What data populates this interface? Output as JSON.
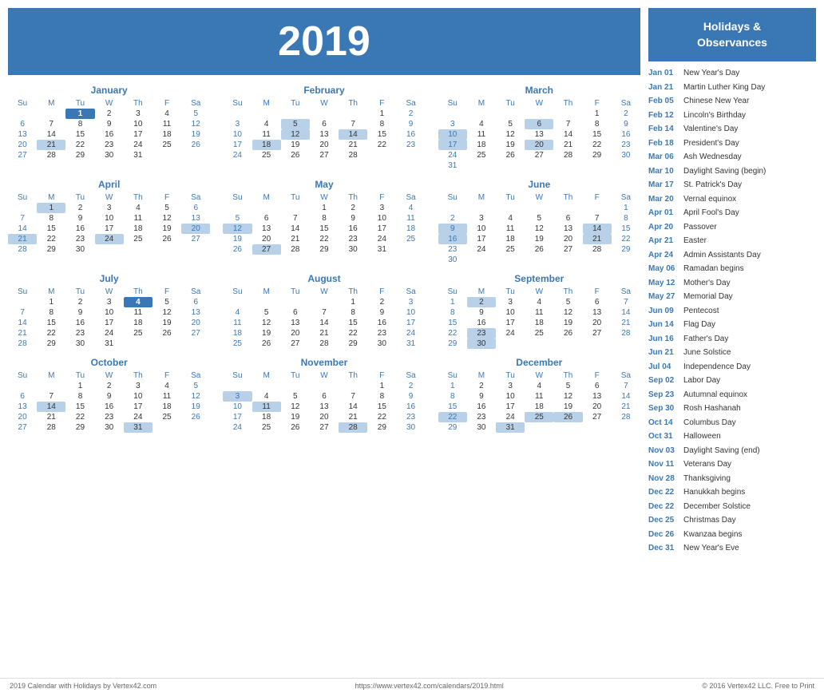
{
  "year": "2019",
  "holidays_title": "Holidays &\nObservances",
  "footer": {
    "left": "2019 Calendar with Holidays by Vertex42.com",
    "center": "https://www.vertex42.com/calendars/2019.html",
    "right": "© 2016 Vertex42 LLC. Free to Print"
  },
  "holidays": [
    {
      "date": "Jan 01",
      "name": "New Year's Day"
    },
    {
      "date": "Jan 21",
      "name": "Martin Luther King Day"
    },
    {
      "date": "Feb 05",
      "name": "Chinese New Year"
    },
    {
      "date": "Feb 12",
      "name": "Lincoln's Birthday"
    },
    {
      "date": "Feb 14",
      "name": "Valentine's Day"
    },
    {
      "date": "Feb 18",
      "name": "President's Day"
    },
    {
      "date": "Mar 06",
      "name": "Ash Wednesday"
    },
    {
      "date": "Mar 10",
      "name": "Daylight Saving (begin)"
    },
    {
      "date": "Mar 17",
      "name": "St. Patrick's Day"
    },
    {
      "date": "Mar 20",
      "name": "Vernal equinox"
    },
    {
      "date": "Apr 01",
      "name": "April Fool's Day"
    },
    {
      "date": "Apr 20",
      "name": "Passover"
    },
    {
      "date": "Apr 21",
      "name": "Easter"
    },
    {
      "date": "Apr 24",
      "name": "Admin Assistants Day"
    },
    {
      "date": "May 06",
      "name": "Ramadan begins"
    },
    {
      "date": "May 12",
      "name": "Mother's Day"
    },
    {
      "date": "May 27",
      "name": "Memorial Day"
    },
    {
      "date": "Jun 09",
      "name": "Pentecost"
    },
    {
      "date": "Jun 14",
      "name": "Flag Day"
    },
    {
      "date": "Jun 16",
      "name": "Father's Day"
    },
    {
      "date": "Jun 21",
      "name": "June Solstice"
    },
    {
      "date": "Jul 04",
      "name": "Independence Day"
    },
    {
      "date": "Sep 02",
      "name": "Labor Day"
    },
    {
      "date": "Sep 23",
      "name": "Autumnal equinox"
    },
    {
      "date": "Sep 30",
      "name": "Rosh Hashanah"
    },
    {
      "date": "Oct 14",
      "name": "Columbus Day"
    },
    {
      "date": "Oct 31",
      "name": "Halloween"
    },
    {
      "date": "Nov 03",
      "name": "Daylight Saving (end)"
    },
    {
      "date": "Nov 11",
      "name": "Veterans Day"
    },
    {
      "date": "Nov 28",
      "name": "Thanksgiving"
    },
    {
      "date": "Dec 22",
      "name": "Hanukkah begins"
    },
    {
      "date": "Dec 22",
      "name": "December Solstice"
    },
    {
      "date": "Dec 25",
      "name": "Christmas Day"
    },
    {
      "date": "Dec 26",
      "name": "Kwanzaa begins"
    },
    {
      "date": "Dec 31",
      "name": "New Year's Eve"
    }
  ],
  "months": [
    {
      "name": "January",
      "weeks": [
        [
          null,
          null,
          1,
          2,
          3,
          4,
          5
        ],
        [
          6,
          7,
          8,
          9,
          10,
          11,
          12
        ],
        [
          13,
          14,
          15,
          16,
          17,
          18,
          19
        ],
        [
          20,
          21,
          22,
          23,
          24,
          25,
          26
        ],
        [
          27,
          28,
          29,
          30,
          31,
          null,
          null
        ]
      ],
      "highlights": {
        "bold": [
          1
        ],
        "light": [
          21
        ]
      }
    },
    {
      "name": "February",
      "weeks": [
        [
          null,
          null,
          null,
          null,
          null,
          1,
          2
        ],
        [
          3,
          4,
          5,
          6,
          7,
          8,
          9
        ],
        [
          10,
          11,
          12,
          13,
          14,
          15,
          16
        ],
        [
          17,
          18,
          19,
          20,
          21,
          22,
          23
        ],
        [
          24,
          25,
          26,
          27,
          28,
          null,
          null
        ]
      ],
      "highlights": {
        "bold": [],
        "light": [
          5,
          12,
          14,
          18
        ]
      }
    },
    {
      "name": "March",
      "weeks": [
        [
          null,
          null,
          null,
          null,
          null,
          1,
          2
        ],
        [
          3,
          4,
          5,
          6,
          7,
          8,
          9
        ],
        [
          10,
          11,
          12,
          13,
          14,
          15,
          16
        ],
        [
          17,
          18,
          19,
          20,
          21,
          22,
          23
        ],
        [
          24,
          25,
          26,
          27,
          28,
          29,
          30
        ],
        [
          31,
          null,
          null,
          null,
          null,
          null,
          null
        ]
      ],
      "highlights": {
        "bold": [],
        "light": [
          6,
          10,
          17,
          20
        ]
      }
    },
    {
      "name": "April",
      "weeks": [
        [
          null,
          1,
          2,
          3,
          4,
          5,
          6
        ],
        [
          7,
          8,
          9,
          10,
          11,
          12,
          13
        ],
        [
          14,
          15,
          16,
          17,
          18,
          19,
          20
        ],
        [
          21,
          22,
          23,
          24,
          25,
          26,
          27
        ],
        [
          28,
          29,
          30,
          null,
          null,
          null,
          null
        ]
      ],
      "highlights": {
        "bold": [],
        "light": [
          1,
          20,
          21,
          24
        ]
      }
    },
    {
      "name": "May",
      "weeks": [
        [
          null,
          null,
          null,
          1,
          2,
          3,
          4
        ],
        [
          5,
          6,
          7,
          8,
          9,
          10,
          11
        ],
        [
          12,
          13,
          14,
          15,
          16,
          17,
          18
        ],
        [
          19,
          20,
          21,
          22,
          23,
          24,
          25
        ],
        [
          26,
          27,
          28,
          29,
          30,
          31,
          null
        ]
      ],
      "highlights": {
        "bold": [],
        "light": [
          12,
          27
        ]
      }
    },
    {
      "name": "June",
      "weeks": [
        [
          null,
          null,
          null,
          null,
          null,
          null,
          1
        ],
        [
          2,
          3,
          4,
          5,
          6,
          7,
          8
        ],
        [
          9,
          10,
          11,
          12,
          13,
          14,
          15
        ],
        [
          16,
          17,
          18,
          19,
          20,
          21,
          22
        ],
        [
          23,
          24,
          25,
          26,
          27,
          28,
          29
        ],
        [
          30,
          null,
          null,
          null,
          null,
          null,
          null
        ]
      ],
      "highlights": {
        "bold": [],
        "light": [
          9,
          14,
          16,
          21
        ]
      }
    },
    {
      "name": "July",
      "weeks": [
        [
          null,
          1,
          2,
          3,
          4,
          5,
          6
        ],
        [
          7,
          8,
          9,
          10,
          11,
          12,
          13
        ],
        [
          14,
          15,
          16,
          17,
          18,
          19,
          20
        ],
        [
          21,
          22,
          23,
          24,
          25,
          26,
          27
        ],
        [
          28,
          29,
          30,
          31,
          null,
          null,
          null
        ]
      ],
      "highlights": {
        "bold": [
          4
        ],
        "light": []
      }
    },
    {
      "name": "August",
      "weeks": [
        [
          null,
          null,
          null,
          null,
          1,
          2,
          3
        ],
        [
          4,
          5,
          6,
          7,
          8,
          9,
          10
        ],
        [
          11,
          12,
          13,
          14,
          15,
          16,
          17
        ],
        [
          18,
          19,
          20,
          21,
          22,
          23,
          24
        ],
        [
          25,
          26,
          27,
          28,
          29,
          30,
          31
        ]
      ],
      "highlights": {
        "bold": [],
        "light": []
      }
    },
    {
      "name": "September",
      "weeks": [
        [
          1,
          2,
          3,
          4,
          5,
          6,
          7
        ],
        [
          8,
          9,
          10,
          11,
          12,
          13,
          14
        ],
        [
          15,
          16,
          17,
          18,
          19,
          20,
          21
        ],
        [
          22,
          23,
          24,
          25,
          26,
          27,
          28
        ],
        [
          29,
          30,
          null,
          null,
          null,
          null,
          null
        ]
      ],
      "highlights": {
        "bold": [],
        "light": [
          2,
          23,
          30
        ]
      }
    },
    {
      "name": "October",
      "weeks": [
        [
          null,
          null,
          1,
          2,
          3,
          4,
          5
        ],
        [
          6,
          7,
          8,
          9,
          10,
          11,
          12
        ],
        [
          13,
          14,
          15,
          16,
          17,
          18,
          19
        ],
        [
          20,
          21,
          22,
          23,
          24,
          25,
          26
        ],
        [
          27,
          28,
          29,
          30,
          31,
          null,
          null
        ]
      ],
      "highlights": {
        "bold": [],
        "light": [
          14,
          31
        ]
      }
    },
    {
      "name": "November",
      "weeks": [
        [
          null,
          null,
          null,
          null,
          null,
          1,
          2
        ],
        [
          3,
          4,
          5,
          6,
          7,
          8,
          9
        ],
        [
          10,
          11,
          12,
          13,
          14,
          15,
          16
        ],
        [
          17,
          18,
          19,
          20,
          21,
          22,
          23
        ],
        [
          24,
          25,
          26,
          27,
          28,
          29,
          30
        ]
      ],
      "highlights": {
        "bold": [],
        "light": [
          3,
          11,
          28
        ]
      }
    },
    {
      "name": "December",
      "weeks": [
        [
          1,
          2,
          3,
          4,
          5,
          6,
          7
        ],
        [
          8,
          9,
          10,
          11,
          12,
          13,
          14
        ],
        [
          15,
          16,
          17,
          18,
          19,
          20,
          21
        ],
        [
          22,
          23,
          24,
          25,
          26,
          27,
          28
        ],
        [
          29,
          30,
          31,
          null,
          null,
          null,
          null
        ]
      ],
      "highlights": {
        "bold": [],
        "light": [
          22,
          25,
          26,
          31
        ]
      }
    }
  ]
}
